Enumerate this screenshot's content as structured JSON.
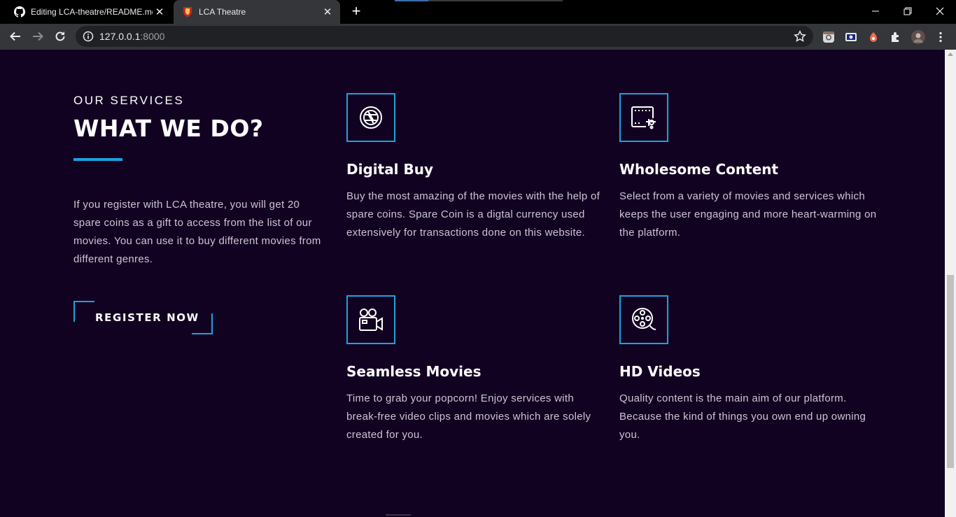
{
  "browser": {
    "tabs": [
      {
        "title": "Editing LCA-theatre/README.md",
        "icon": "github-icon",
        "active": false
      },
      {
        "title": "LCA Theatre",
        "icon": "lca-logo-icon",
        "active": true
      }
    ],
    "new_tab_label": "+",
    "url_host": "127.0.0.1",
    "url_port": ":8000"
  },
  "services_section": {
    "eyebrow": "OUR SERVICES",
    "heading": "WHAT WE DO?",
    "intro": "If you register with LCA theatre, you will get 20 spare coins as a gift to access from the list of our movies. You can use it to buy different movies from different genres.",
    "register_label": "REGISTER NOW",
    "accent_color": "#1aa3dd",
    "background_color": "#120222",
    "items": [
      {
        "icon": "aperture-icon",
        "title": "Digital Buy",
        "description": "Buy the most amazing of the movies with the help of spare coins. Spare Coin is a digtal currency used extensively for transactions done on this website."
      },
      {
        "icon": "film-edit-icon",
        "title": "Wholesome Content",
        "description": "Select from a variety of movies and services which keeps the user engaging and more heart-warming on the platform."
      },
      {
        "icon": "movie-camera-icon",
        "title": "Seamless Movies",
        "description": "Time to grab your popcorn! Enjoy services with break-free video clips and movies which are solely created for you."
      },
      {
        "icon": "film-reel-icon",
        "title": "HD Videos",
        "description": "Quality content is the main aim of our platform. Because the kind of things you own end up owning you."
      }
    ]
  }
}
